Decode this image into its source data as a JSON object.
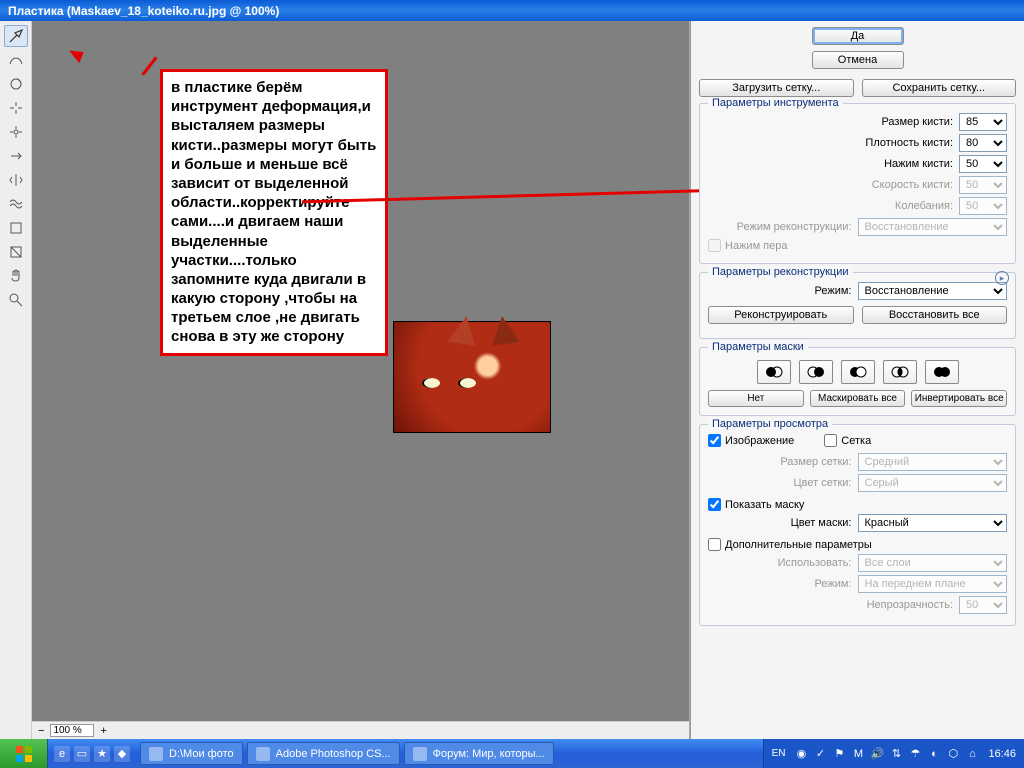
{
  "window_title": "Пластика (Maskaev_18_koteiko.ru.jpg @ 100%)",
  "annotation_text": "в пластике берём инструмент деформация,и высталяем размеры кисти..размеры могут быть и больше и меньше всё зависит от выделенной области..корректируйте сами....и двигаем наши выделенные участки....только запомните куда двигали в какую сторону ,чтобы на третьем слое ,не двигать снова в эту же сторону",
  "zoom": "100 %",
  "buttons": {
    "ok": "Да",
    "cancel": "Отмена",
    "load_mesh": "Загрузить сетку...",
    "save_mesh": "Сохранить сетку...",
    "reconstruct": "Реконструировать",
    "restore_all": "Восстановить все",
    "mask_none": "Нет",
    "mask_all": "Маскировать все",
    "mask_invert": "Инвертировать все"
  },
  "groups": {
    "tool": "Параметры инструмента",
    "recon": "Параметры реконструкции",
    "mask": "Параметры маски",
    "view": "Параметры просмотра"
  },
  "labels": {
    "brush_size": "Размер кисти:",
    "brush_density": "Плотность кисти:",
    "brush_pressure": "Нажим кисти:",
    "brush_rate": "Скорость кисти:",
    "turbulence": "Колебания:",
    "recon_mode": "Режим реконструкции:",
    "pen_pressure": "Нажим пера",
    "mode": "Режим:",
    "image": "Изображение",
    "mesh": "Сетка",
    "mesh_size": "Размер сетки:",
    "mesh_color": "Цвет сетки:",
    "show_mask": "Показать маску",
    "mask_color": "Цвет маски:",
    "additional": "Дополнительные параметры",
    "use": "Использовать:",
    "mode2": "Режим:",
    "opacity": "Непрозрачность:"
  },
  "values": {
    "brush_size": "85",
    "brush_density": "80",
    "brush_pressure": "50",
    "brush_rate": "50",
    "turbulence": "50",
    "recon_mode": "Восстановление",
    "mode": "Восстановление",
    "mesh_size": "Средний",
    "mesh_color": "Серый",
    "mask_color": "Красный",
    "use": "Все слои",
    "mode2": "На переднем плане",
    "opacity": "50"
  },
  "checks": {
    "image": true,
    "mesh": false,
    "show_mask": true,
    "additional": false
  },
  "taskbar": {
    "items": [
      "D:\\Мои фото",
      "Adobe Photoshop CS...",
      "Форум: Мир, которы..."
    ],
    "lang": "EN",
    "clock": "16:46"
  }
}
